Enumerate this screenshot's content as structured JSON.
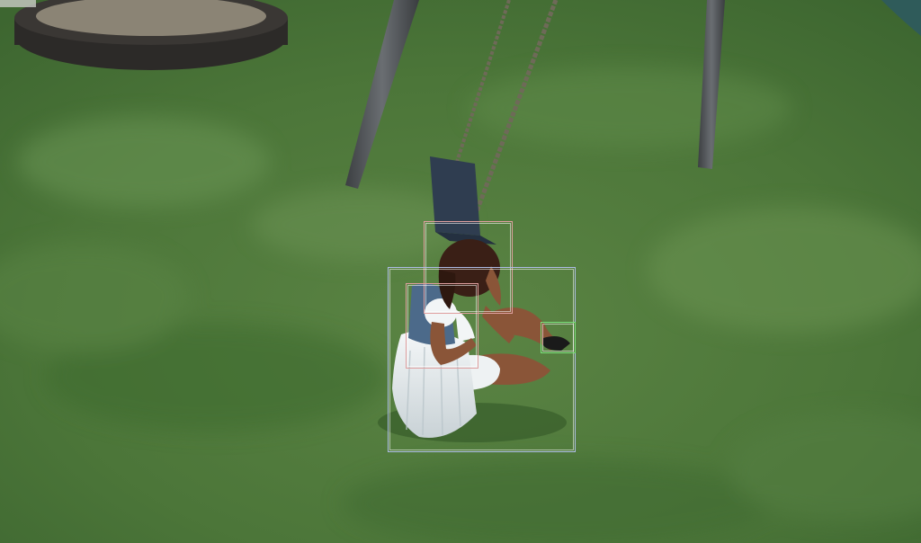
{
  "scene": {
    "description_free": true,
    "colors": {
      "grass_dark": "#3f6a2f",
      "grass_mid": "#4f7a3c",
      "grass_light": "#6a8f50",
      "pole": "#55595d",
      "seat": "#2f3d50",
      "chain": "#6e6a58",
      "sandbox_rim": "#2c2a28",
      "sand": "#8b8475",
      "skin": "#8a5538",
      "hair": "#3a1f16",
      "vest": "#4c6a8a",
      "dress": "#e8eef0",
      "shoe": "#1a1a1a"
    }
  },
  "annotations": [
    {
      "label_color": "#e0a0a0",
      "kind": "head"
    },
    {
      "label_color": "#e0a0a0",
      "kind": "torso"
    },
    {
      "label_color": "#aebde6",
      "kind": "person"
    },
    {
      "label_color": "#7be07b",
      "kind": "shoe"
    }
  ]
}
